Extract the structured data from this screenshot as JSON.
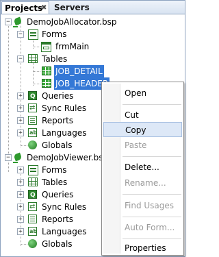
{
  "tabs": {
    "projects": "Projects",
    "servers": "Servers",
    "close_glyph": "✖"
  },
  "tree": {
    "project1": {
      "name": "DemoJobAllocator.bsp",
      "forms": "Forms",
      "form_item": "frmMain",
      "tables": "Tables",
      "table_items": [
        "JOB_DETAIL",
        "JOB_HEADER"
      ],
      "queries": "Queries",
      "sync_rules": "Sync Rules",
      "reports": "Reports",
      "languages": "Languages",
      "globals": "Globals"
    },
    "project2": {
      "name": "DemoJobViewer.bsp",
      "forms": "Forms",
      "tables": "Tables",
      "queries": "Queries",
      "sync_rules": "Sync Rules",
      "reports": "Reports",
      "languages": "Languages",
      "globals": "Globals"
    },
    "expand_glyph": "+",
    "collapse_glyph": "−"
  },
  "context_menu": {
    "open": "Open",
    "cut": "Cut",
    "copy": "Copy",
    "paste": "Paste",
    "delete": "Delete...",
    "rename": "Rename...",
    "find_usages": "Find Usages",
    "auto_form": "Auto Form...",
    "properties": "Properties"
  },
  "colors": {
    "selection": "#3478d6",
    "accent_green": "#2b7a2b",
    "menu_highlight": "#dde8f7"
  }
}
